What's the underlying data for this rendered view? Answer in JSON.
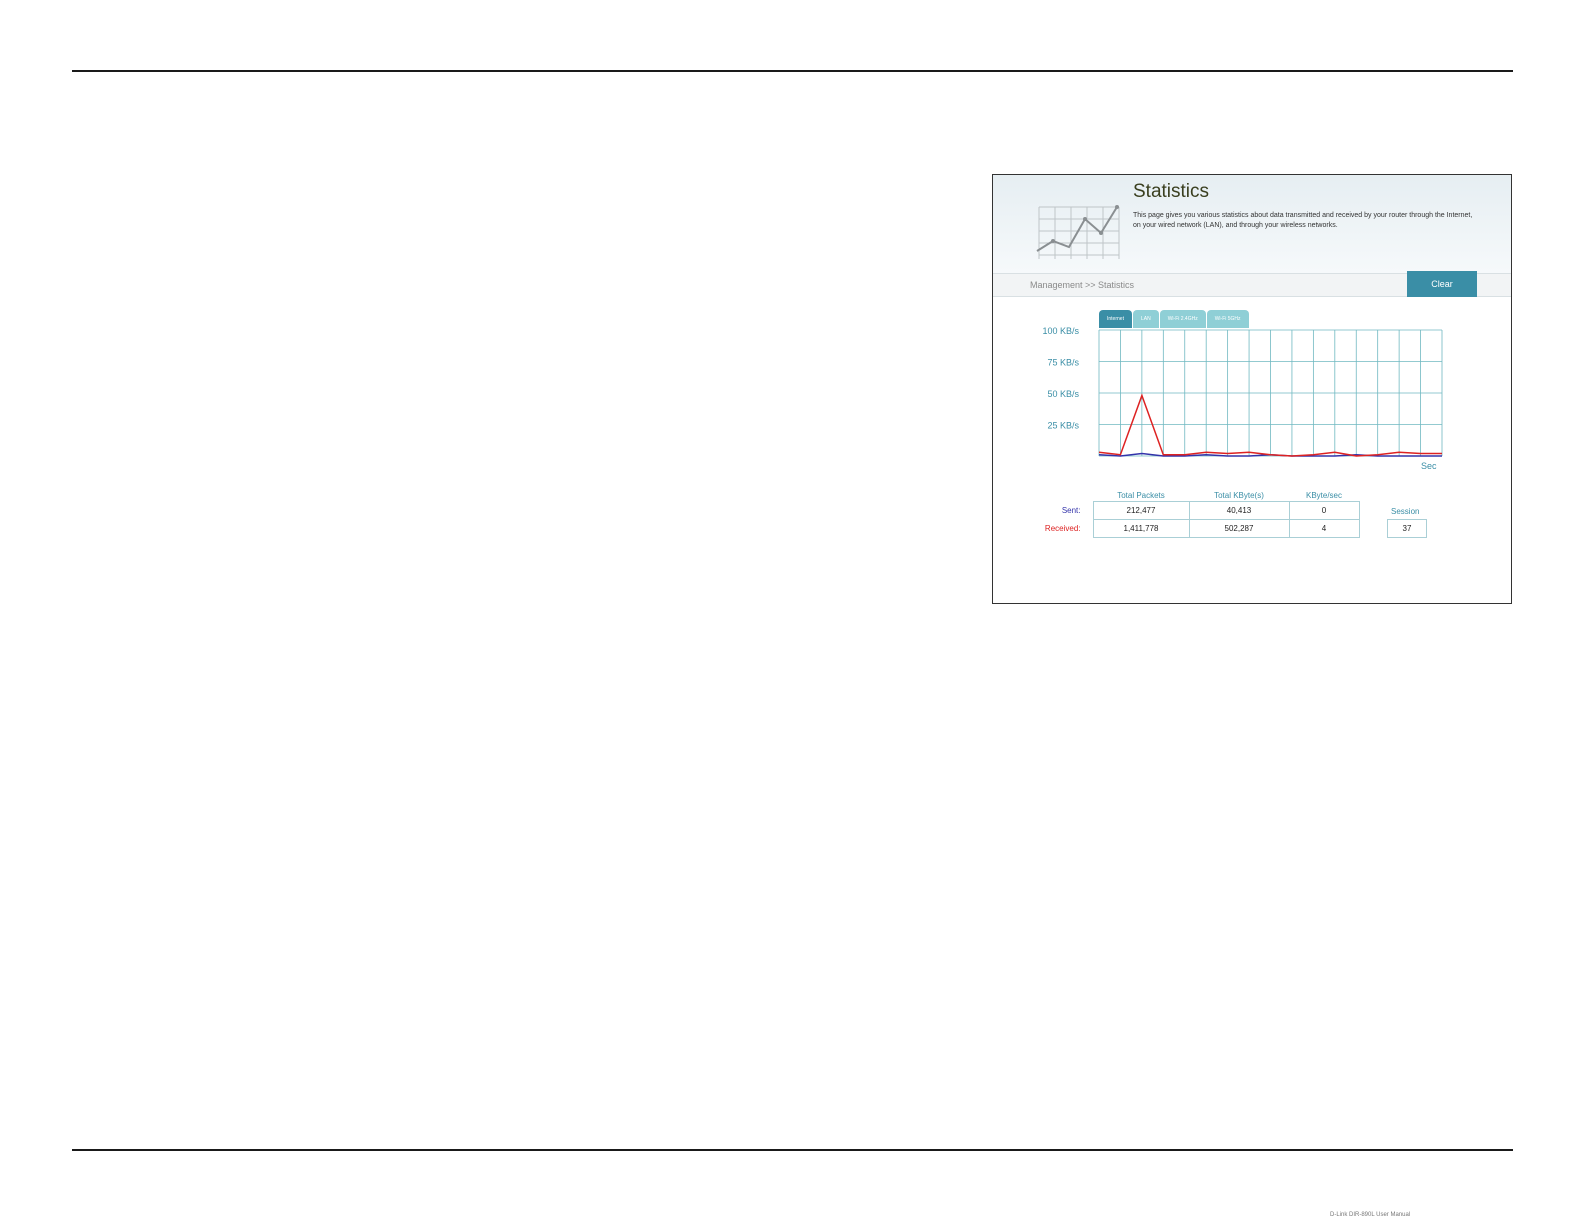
{
  "header": {
    "title": "Statistics",
    "description": "This page gives you various statistics about data transmitted and received by your router through the Internet, on your wired network (LAN), and through your wireless networks."
  },
  "breadcrumb": "Management >> Statistics",
  "clear_label": "Clear",
  "tabs": [
    {
      "label": "Internet",
      "active": true
    },
    {
      "label": "LAN",
      "active": false
    },
    {
      "label": "Wi-Fi 2.4GHz",
      "active": false
    },
    {
      "label": "Wi-Fi 5GHz",
      "active": false
    }
  ],
  "chart_data": {
    "type": "line",
    "y_tick_labels": [
      "100 KB/s",
      "75 KB/s",
      "50 KB/s",
      "25 KB/s"
    ],
    "x_label": "Sec",
    "ylim": [
      0,
      100
    ],
    "series": [
      {
        "values": [
          1,
          0,
          2,
          0,
          0,
          1,
          0,
          0,
          1,
          0,
          0,
          0,
          1,
          0,
          0,
          0,
          0
        ],
        "color": "#3333aa"
      },
      {
        "values": [
          3,
          1,
          48,
          1,
          1,
          3,
          2,
          3,
          1,
          0,
          1,
          3,
          0,
          1,
          3,
          2,
          2
        ],
        "color": "#dd2222"
      }
    ],
    "colors": {
      "grid": "#6fb8c1",
      "axis_label": "#3a8ea6"
    }
  },
  "stats": {
    "columns": [
      "Total Packets",
      "Total KByte(s)",
      "KByte/sec"
    ],
    "sent": {
      "label": "Sent:",
      "values": [
        "212,477",
        "40,413",
        "0"
      ]
    },
    "received": {
      "label": "Received:",
      "values": [
        "1,411,778",
        "502,287",
        "4"
      ]
    },
    "session_label": "Session",
    "session_value": "37"
  },
  "footer_text": "D-Link DIR-890L User Manual"
}
